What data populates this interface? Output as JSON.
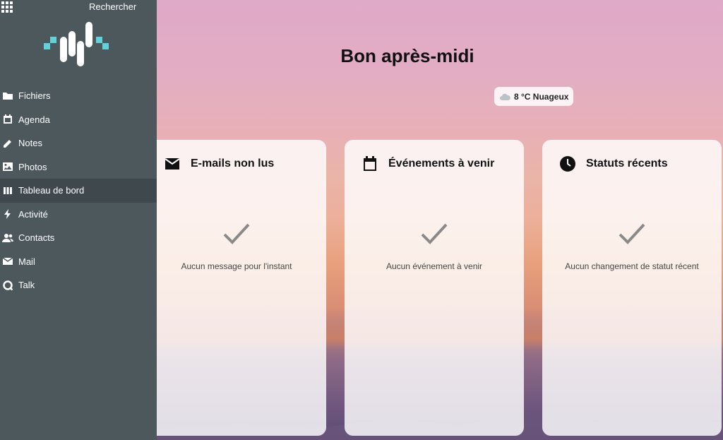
{
  "header": {
    "search_label": "Rechercher"
  },
  "sidebar": {
    "items": [
      {
        "label": "Fichiers",
        "icon": "folder-icon"
      },
      {
        "label": "Agenda",
        "icon": "calendar-icon"
      },
      {
        "label": "Notes",
        "icon": "pencil-icon"
      },
      {
        "label": "Photos",
        "icon": "image-icon"
      },
      {
        "label": "Tableau de bord",
        "icon": "dashboard-icon",
        "active": true
      },
      {
        "label": "Activité",
        "icon": "lightning-icon"
      },
      {
        "label": "Contacts",
        "icon": "contacts-icon"
      },
      {
        "label": "Mail",
        "icon": "mail-icon"
      },
      {
        "label": "Talk",
        "icon": "talk-icon"
      }
    ]
  },
  "main": {
    "greeting": "Bon après-midi",
    "weather": {
      "text": "8 °C Nuageux",
      "icon": "cloud-icon"
    },
    "panels": [
      {
        "title": "E-mails non lus",
        "icon": "mail-icon",
        "empty": "Aucun message pour l'instant"
      },
      {
        "title": "Événements à venir",
        "icon": "calendar-icon",
        "empty": "Aucun événement à venir"
      },
      {
        "title": "Statuts récents",
        "icon": "clock-icon",
        "empty": "Aucun changement de statut récent"
      }
    ]
  },
  "colors": {
    "sidebar": "#4d585d",
    "sidebar_active": "#3f494d",
    "logo_accent": "#5fd3d9"
  }
}
